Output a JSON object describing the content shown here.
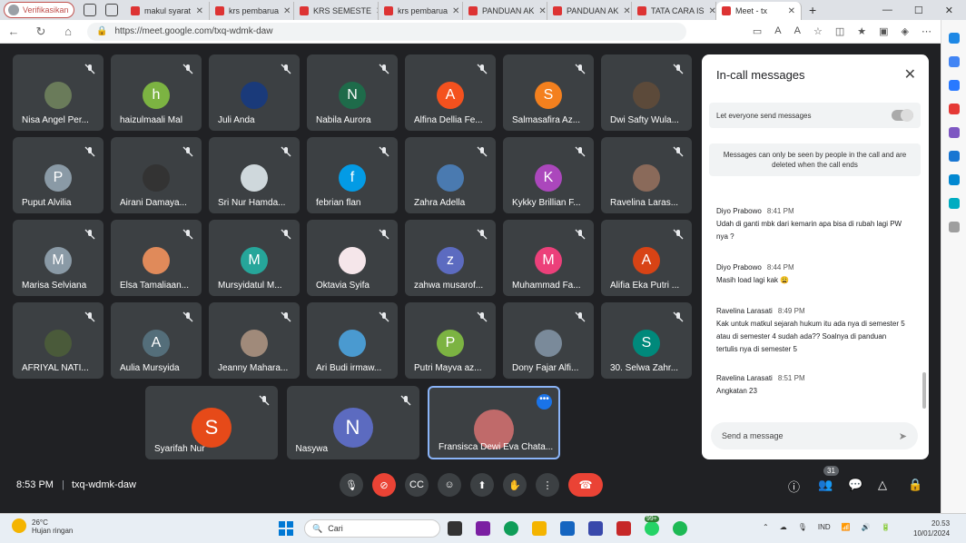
{
  "browser": {
    "profile": "Verifikasikan",
    "tabs": [
      "makul syarat",
      "krs pembarua",
      "KRS SEMESTE",
      "krs pembarua",
      "PANDUAN AK",
      "PANDUAN AK",
      "TATA CARA IS",
      "Meet - tx"
    ],
    "url": "https://meet.google.com/txq-wdmk-daw"
  },
  "participants": [
    {
      "name": "Nisa Angel Per...",
      "initial": "",
      "color": "#6a7b5a"
    },
    {
      "name": "haizulmaali Mal",
      "initial": "h",
      "color": "#7cb342"
    },
    {
      "name": "Juli Anda",
      "initial": "",
      "color": "#1a3a7a"
    },
    {
      "name": "Nabila Aurora",
      "initial": "N",
      "color": "#1e6b4a"
    },
    {
      "name": "Alfina Dellia Fe...",
      "initial": "A",
      "color": "#f4511e"
    },
    {
      "name": "Salmasafira Az...",
      "initial": "S",
      "color": "#f4801e"
    },
    {
      "name": "Dwi Safty Wula...",
      "initial": "",
      "color": "#5c4a3a"
    },
    {
      "name": "Puput Alvilia",
      "initial": "P",
      "color": "#8a9aa6"
    },
    {
      "name": "Airani Damaya...",
      "initial": "",
      "color": "#333333"
    },
    {
      "name": "Sri Nur Hamda...",
      "initial": "",
      "color": "#cfd8dc"
    },
    {
      "name": "febrian flan",
      "initial": "f",
      "color": "#039be5"
    },
    {
      "name": "Zahra Adella",
      "initial": "",
      "color": "#4a7ab0"
    },
    {
      "name": "Kykky Brillian F...",
      "initial": "K",
      "color": "#ab47bc"
    },
    {
      "name": "Ravelina Laras...",
      "initial": "",
      "color": "#8a6a5a"
    },
    {
      "name": "Marisa Selviana",
      "initial": "M",
      "color": "#8a9aa6"
    },
    {
      "name": "Elsa Tamaliaan...",
      "initial": "",
      "color": "#e08a5a"
    },
    {
      "name": "Mursyidatul M...",
      "initial": "M",
      "color": "#26a69a"
    },
    {
      "name": "Oktavia Syifa",
      "initial": "",
      "color": "#f5e6ea"
    },
    {
      "name": "zahwa musarof...",
      "initial": "z",
      "color": "#5c6bc0"
    },
    {
      "name": "Muhammad Fa...",
      "initial": "M",
      "color": "#ec407a"
    },
    {
      "name": "Alifia Eka Putri ...",
      "initial": "A",
      "color": "#d84315"
    },
    {
      "name": "AFRIYAL NATI...",
      "initial": "",
      "color": "#4a5a3a"
    },
    {
      "name": "Aulia Mursyida",
      "initial": "A",
      "color": "#546e7a"
    },
    {
      "name": "Jeanny Mahara...",
      "initial": "",
      "color": "#a08a7a"
    },
    {
      "name": "Ari Budi irmaw...",
      "initial": "",
      "color": "#4a9ad0"
    },
    {
      "name": "Putri Mayva az...",
      "initial": "P",
      "color": "#7cb342"
    },
    {
      "name": "Dony Fajar Alfi...",
      "initial": "",
      "color": "#7a8a9a"
    },
    {
      "name": "30. Selwa Zahr...",
      "initial": "S",
      "color": "#00897b"
    }
  ],
  "bottom_row": [
    {
      "name": "Syarifah Nur",
      "initial": "S",
      "color": "#e64a19"
    },
    {
      "name": "Nasywa",
      "initial": "N",
      "color": "#5c6bc0"
    },
    {
      "name": "Fransisca Dewi Eva Chata...",
      "initial": "",
      "color": "#c06a6a"
    }
  ],
  "panel": {
    "title": "In-call messages",
    "toggle_label": "Let everyone send messages",
    "info": "Messages can only be seen by people in the call and are deleted when the call ends",
    "send_placeholder": "Send a message"
  },
  "messages": [
    {
      "sender": "Diyo Prabowo",
      "time": "8:41 PM",
      "text": "Udah di ganti mbk dari kemarin apa bisa di rubah lagi PW nya ?"
    },
    {
      "sender": "Diyo Prabowo",
      "time": "8:44 PM",
      "text": "Masih load lagi kak 😩"
    },
    {
      "sender": "Ravelina Larasati",
      "time": "8:49 PM",
      "text": "Kak untuk matkul sejarah hukum itu ada nya di semester 5 atau di semester 4 sudah ada?? Soalnya di panduan tertulis nya di semester 5"
    },
    {
      "sender": "Ravelina Larasati",
      "time": "8:51 PM",
      "text": "Angkatan 23"
    }
  ],
  "call": {
    "time": "8:53 PM",
    "code": "txq-wdmk-daw",
    "participant_count": "31"
  },
  "taskbar": {
    "temp": "26°C",
    "weather": "Hujan ringan",
    "search": "Cari",
    "lang": "IND",
    "time": "20.53",
    "date": "10/01/2024",
    "badge": "99+"
  }
}
